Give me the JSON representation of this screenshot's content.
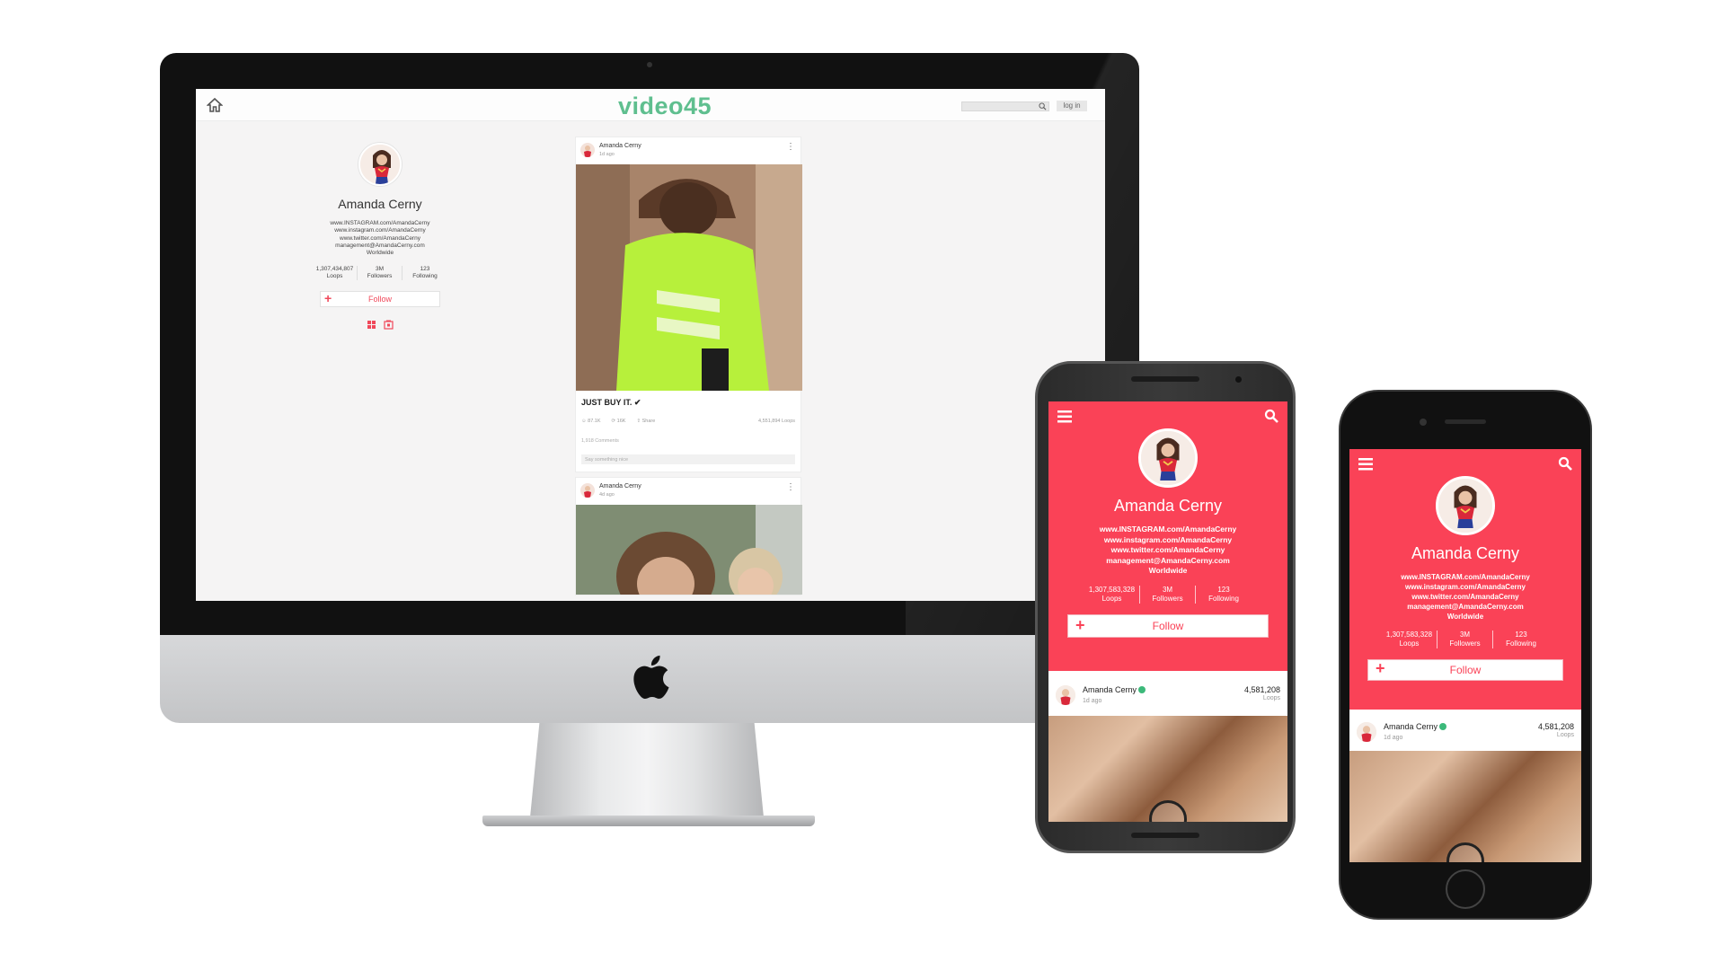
{
  "colors": {
    "brand_green": "#5fbf8f",
    "accent_red": "#fa4257",
    "follow_red": "#f0485a"
  },
  "desktop": {
    "brand": "video45",
    "login_label": "log in",
    "profile": {
      "name": "Amanda Cerny",
      "info": [
        "www.INSTAGRAM.com/AmandaCerny",
        "www.instagram.com/AmandaCerny",
        "www.twitter.com/AmandaCerny",
        "management@AmandaCerny.com",
        "Worldwide"
      ],
      "stats": [
        {
          "value": "1,307,434,807",
          "label": "Loops"
        },
        {
          "value": "3M",
          "label": "Followers"
        },
        {
          "value": "123",
          "label": "Following"
        }
      ],
      "follow_label": "Follow"
    },
    "posts": [
      {
        "user": "Amanda Cerny",
        "time": "1d ago",
        "caption": "JUST BUY IT. ✔",
        "likes": "87.1K",
        "reposts": "16K",
        "share": "Share",
        "loops": "4,551,894 Loops",
        "comments": "1,918 Comments",
        "say_placeholder": "Say something nice"
      },
      {
        "user": "Amanda Cerny",
        "time": "4d ago"
      }
    ]
  },
  "android": {
    "profile": {
      "name": "Amanda Cerny",
      "info": [
        "www.INSTAGRAM.com/AmandaCerny",
        "www.instagram.com/AmandaCerny",
        "www.twitter.com/AmandaCerny",
        "management@AmandaCerny.com",
        "Worldwide"
      ],
      "stats": [
        {
          "value": "1,307,583,328",
          "label": "Loops"
        },
        {
          "value": "3M",
          "label": "Followers"
        },
        {
          "value": "123",
          "label": "Following"
        }
      ],
      "follow_label": "Follow"
    },
    "post": {
      "user": "Amanda Cerny",
      "time": "1d ago",
      "count": "4,581,208",
      "count_label": "Loops"
    }
  },
  "iphone": {
    "profile": {
      "name": "Amanda Cerny",
      "info": [
        "www.INSTAGRAM.com/AmandaCerny",
        "www.instagram.com/AmandaCerny",
        "www.twitter.com/AmandaCerny",
        "management@AmandaCerny.com",
        "Worldwide"
      ],
      "stats": [
        {
          "value": "1,307,583,328",
          "label": "Loops"
        },
        {
          "value": "3M",
          "label": "Followers"
        },
        {
          "value": "123",
          "label": "Following"
        }
      ],
      "follow_label": "Follow"
    },
    "post": {
      "user": "Amanda Cerny",
      "time": "1d ago",
      "count": "4,581,208",
      "count_label": "Loops"
    }
  }
}
